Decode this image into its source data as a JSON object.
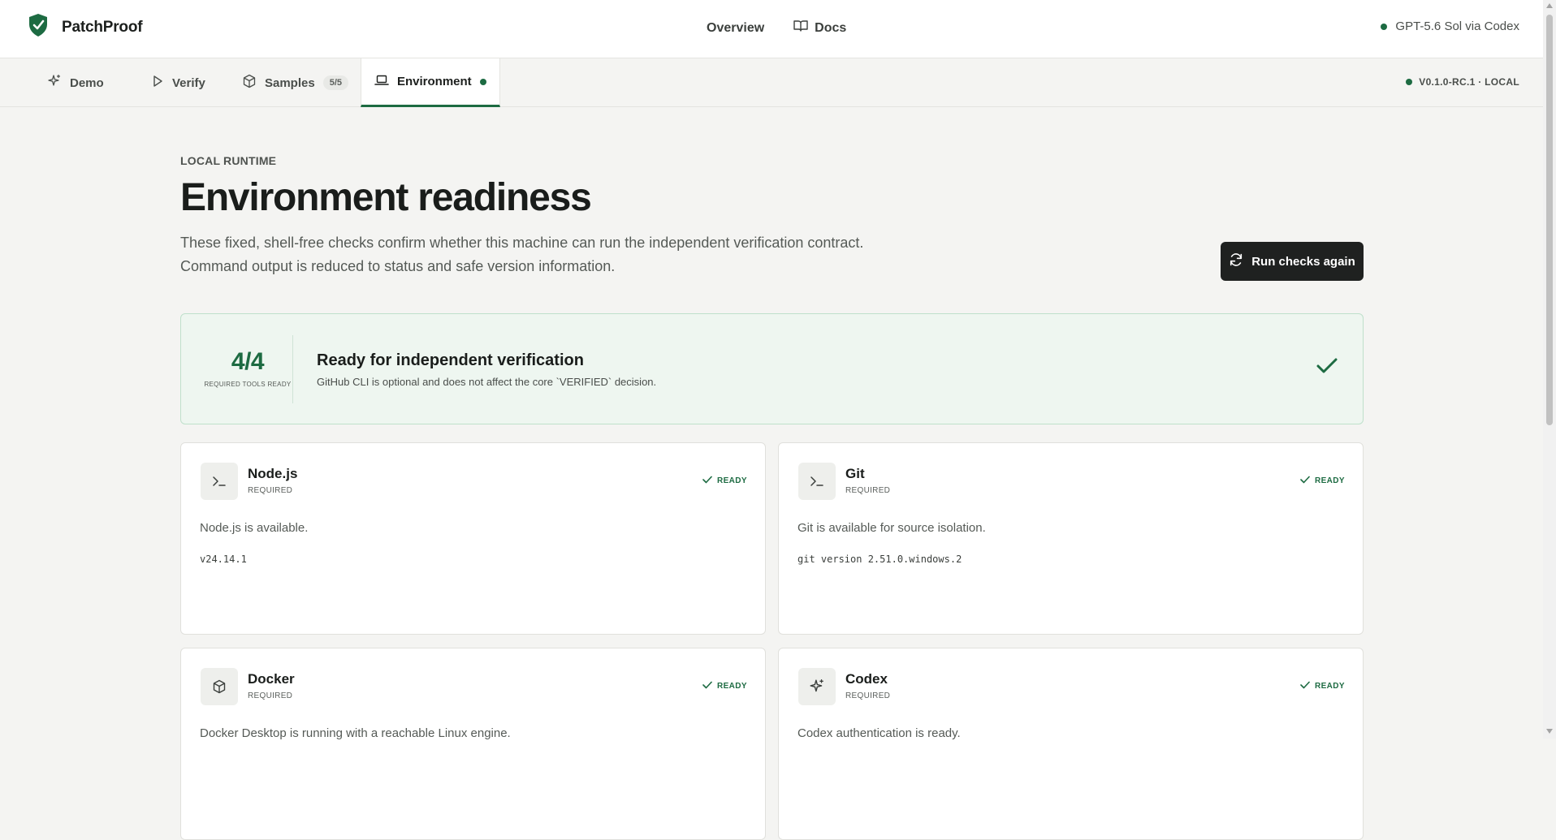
{
  "app": {
    "name": "PatchProof",
    "brand_color": "#1d6b42"
  },
  "topnav": {
    "overview": "Overview",
    "docs": "Docs"
  },
  "model": {
    "label": "GPT-5.6 Sol via Codex"
  },
  "tabs": [
    {
      "label": "Demo",
      "icon": "sparkle-icon"
    },
    {
      "label": "Verify",
      "icon": "play-icon"
    },
    {
      "label": "Samples",
      "icon": "cube-icon",
      "badge": "5/5"
    },
    {
      "label": "Environment",
      "icon": "laptop-icon",
      "active": true
    }
  ],
  "version": {
    "label": "V0.1.0-RC.1 · LOCAL"
  },
  "page": {
    "eyebrow": "LOCAL RUNTIME",
    "title": "Environment readiness",
    "description": "These fixed, shell-free checks confirm whether this machine can run the independent verification contract. Command output is reduced to status and safe version information.",
    "run_button": "Run checks again"
  },
  "summary": {
    "score": "4/4",
    "score_label": "REQUIRED TOOLS READY",
    "heading": "Ready for independent verification",
    "subtext": "GitHub CLI is optional and does not affect the core `VERIFIED` decision."
  },
  "cards": [
    {
      "name": "Node.js",
      "requirement": "REQUIRED",
      "status": "READY",
      "message": "Node.js is available.",
      "version": "v24.14.1",
      "icon": "terminal-icon"
    },
    {
      "name": "Git",
      "requirement": "REQUIRED",
      "status": "READY",
      "message": "Git is available for source isolation.",
      "version": "git version 2.51.0.windows.2",
      "icon": "terminal-icon"
    },
    {
      "name": "Docker",
      "requirement": "REQUIRED",
      "status": "READY",
      "message": "Docker Desktop is running with a reachable Linux engine.",
      "version": "",
      "icon": "cube-icon"
    },
    {
      "name": "Codex",
      "requirement": "REQUIRED",
      "status": "READY",
      "message": "Codex authentication is ready.",
      "version": "",
      "icon": "sparkle-icon"
    }
  ]
}
